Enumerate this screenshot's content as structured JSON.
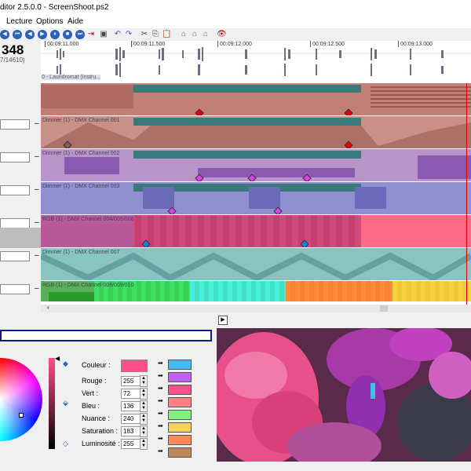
{
  "window": {
    "title": "ditor 2.5.0.0 - ScreenShoot.ps2"
  },
  "menu": [
    {
      "label": "Lecture"
    },
    {
      "label": "Options"
    },
    {
      "label": "Aide"
    }
  ],
  "time": {
    "current": "348",
    "frame_info": "7/14610)"
  },
  "timeline": {
    "ticks": [
      "00:09:11.000",
      "00:09:11.500",
      "00:09:12.000",
      "00:09:12.500",
      "00:09:13.000"
    ],
    "audio_label": "0 - Laundromat (Instru..."
  },
  "tracks": [
    {
      "label": ""
    },
    {
      "label": "Dimmer (1) - DMX Channel 001"
    },
    {
      "label": "Dimmer (1) - DMX Channel 002"
    },
    {
      "label": "Dimmer (1) - DMX Channel 003"
    },
    {
      "label": "RGB (1) - DMX Channel 004/005/006"
    },
    {
      "label": "Dimmer (1) - DMX Channel 007"
    },
    {
      "label": "RGB (1) - DMX Channel 008/009/010"
    }
  ],
  "color_editor": {
    "color_label": "Couleur :",
    "current_color": "#ff4f88",
    "params": [
      {
        "label": "Rouge :",
        "value": "255"
      },
      {
        "label": "Vert :",
        "value": "72"
      },
      {
        "label": "Bleu :",
        "value": "136"
      },
      {
        "label": "Nuance :",
        "value": "240"
      },
      {
        "label": "Saturation :",
        "value": "183"
      },
      {
        "label": "Luminosité :",
        "value": "255"
      }
    ],
    "swatches": [
      "#48b8f0",
      "#c060f0",
      "#ff4f88",
      "#ff8080",
      "#80f080",
      "#f8d060",
      "#ff8858",
      "#c08858"
    ]
  }
}
